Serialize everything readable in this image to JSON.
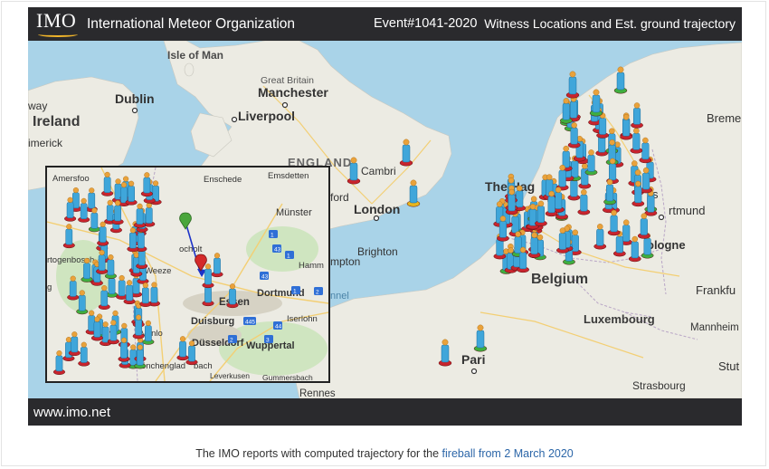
{
  "header": {
    "logo": "IMO",
    "org_name": "International Meteor Organization",
    "event_id": "Event#1041-2020",
    "title": "Witness Locations and Est. ground trajectory"
  },
  "footer": {
    "site": "www.imo.net"
  },
  "caption": {
    "prefix": "The IMO reports with computed trajectory for the ",
    "link1": "fireball",
    "link2": " from 2 March 2020"
  },
  "map_labels": {
    "isle_of_man": "Isle of Man",
    "great_britain": "Great Britain",
    "manchester": "Manchester",
    "dublin": "Dublin",
    "ireland": "Ireland",
    "liverpool": "Liverpool",
    "limerick": "imerick",
    "way": "way",
    "england": "ENGLAND",
    "cambridge": "Cambri",
    "the_hague": "The Hag",
    "london": "London",
    "brighton": "Brighton",
    "southampton": "mpton",
    "oxford": "ford",
    "belgium": "Belgium",
    "bremen": "Breme",
    "dortmund_main": "rtmund",
    "cologne": "ologne",
    "frankfurt": "Frankfu",
    "luxembourg": "Luxembourg",
    "mannheim": "Mannheim",
    "paris": "Pari",
    "stuttgart": "Stut",
    "strasbourg": "Strasbourg",
    "rennes": "Rennes",
    "channel": "nnel",
    "s_mark": "s"
  },
  "inset_labels": {
    "amersfoort": "Amersfoo",
    "enschede": "Enschede",
    "emsdetten": "Emsdetten",
    "munster": "Münster",
    "hamm": "Hamm",
    "dortmund": "Dortmund",
    "essen": "Essen",
    "duisburg": "Duisburg",
    "dusseldorf": "Düsseldorf",
    "wuppertal": "Wuppertal",
    "iserlohn": "Iserlohn",
    "venlo": "Venlo",
    "monchengladbach": "Mönchenglad",
    "bach": "bach",
    "leverkusen": "Leverkusen",
    "gummersbach": "Gummersbach",
    "bocholt": "ocholt",
    "hertogenbosch": "rtogenbosch",
    "weeze": "Weeze",
    "g": "g"
  },
  "road_shields": [
    "1",
    "1",
    "1",
    "43",
    "43",
    "2",
    "445",
    "3",
    "44",
    "2"
  ],
  "colors": {
    "sea": "#a9d3e8",
    "land": "#ecebe3",
    "bar": "#2a2a2d",
    "marker_blue": "#3fa6da",
    "marker_base_red": "#c8242d",
    "marker_base_green": "#3fae3f",
    "marker_base_yellow": "#e8b61e",
    "trajectory": "#1d33c8"
  }
}
